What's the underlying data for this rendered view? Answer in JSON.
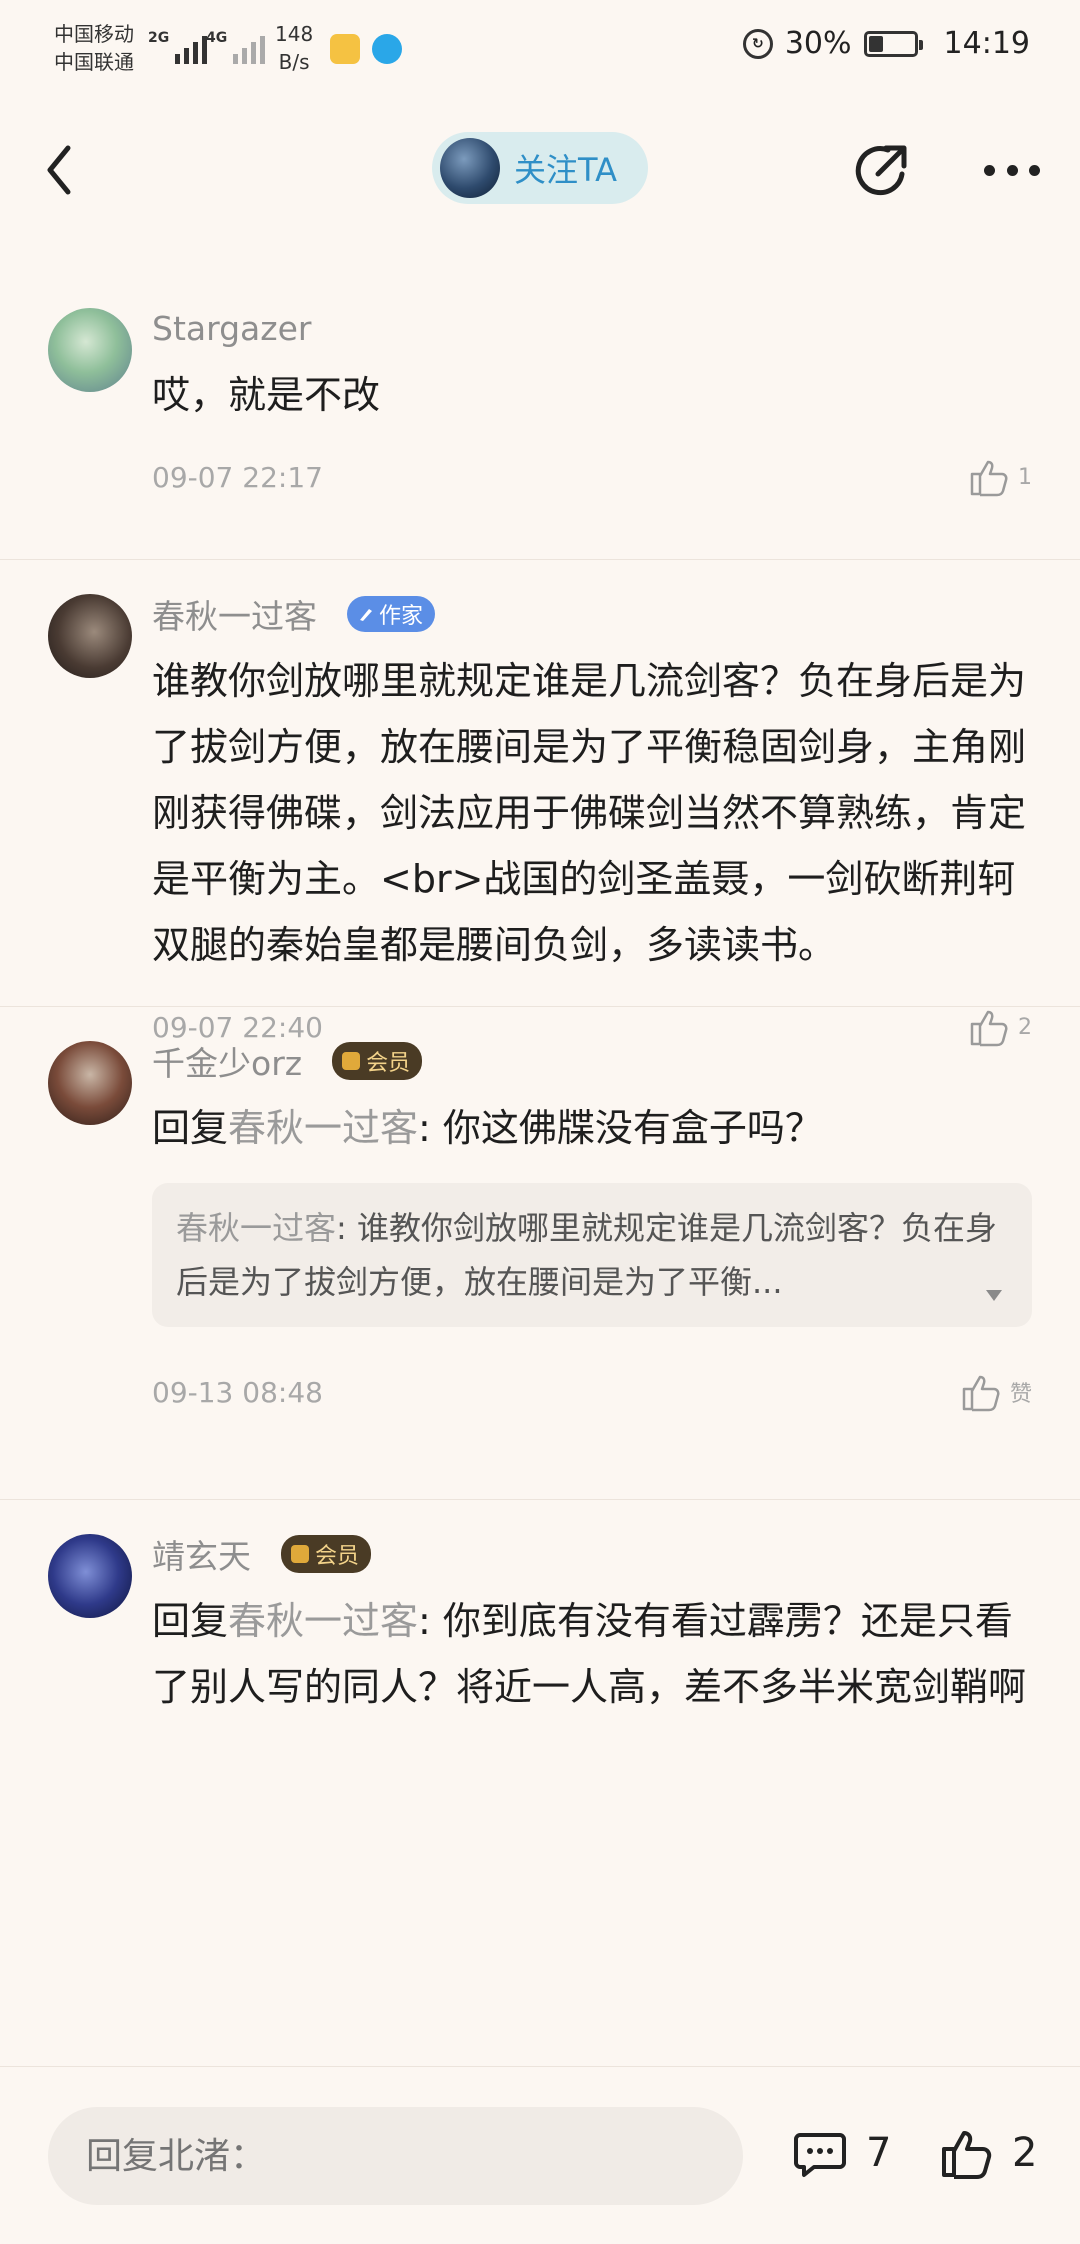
{
  "status_bar": {
    "carrier1": "中国移动",
    "carrier2": "中国联通",
    "signal1_gen": "2G",
    "signal2_gen": "4G",
    "net_speed_value": "148",
    "net_speed_unit": "B/s",
    "battery_percent": "30%",
    "battery_level": 0.3,
    "time": "14:19"
  },
  "nav": {
    "follow_label": "关注TA"
  },
  "comments": [
    {
      "user": "Stargazer",
      "badge": "",
      "text": "哎，就是不改",
      "time": "09-07 22:17",
      "likes": "1"
    },
    {
      "user": "春秋一过客",
      "badge": "作家",
      "text": "谁教你剑放哪里就规定谁是几流剑客？负在身后是为了拔剑方便，放在腰间是为了平衡稳固剑身，主角刚刚获得佛碟，剑法应用于佛碟剑当然不算熟练，肯定是平衡为主。<br>战国的剑圣盖聂，一剑砍断荆轲双腿的秦始皇都是腰间负剑，多读读书。",
      "time": "09-07 22:40",
      "likes": "2"
    },
    {
      "user": "千金少orz",
      "badge": "会员",
      "reply_prefix": "回复",
      "reply_to": "春秋一过客",
      "text": ": 你这佛牒没有盒子吗？",
      "quote_user": "春秋一过客",
      "quote_text": ": 谁教你剑放哪里就规定谁是几流剑客？负在身后是为了拔剑方便，放在腰间是为了平衡...",
      "time": "09-13 08:48",
      "likes": "赞"
    },
    {
      "user": "靖玄天",
      "badge": "会员",
      "reply_prefix": "回复",
      "reply_to": "春秋一过客",
      "text": ": 你到底有没有看过霹雳？还是只看了别人写的同人？将近一人高，差不多半米宽剑鞘啊"
    }
  ],
  "bottom": {
    "reply_placeholder": "回复北渚：",
    "comment_count": "7",
    "like_count": "2"
  },
  "colors": {
    "background": "#fcf7f2",
    "follow_pill": "#d9ecee",
    "follow_text": "#2f8fc7",
    "writer_badge": "#5b8ee6",
    "member_badge": "#4a3b25"
  }
}
